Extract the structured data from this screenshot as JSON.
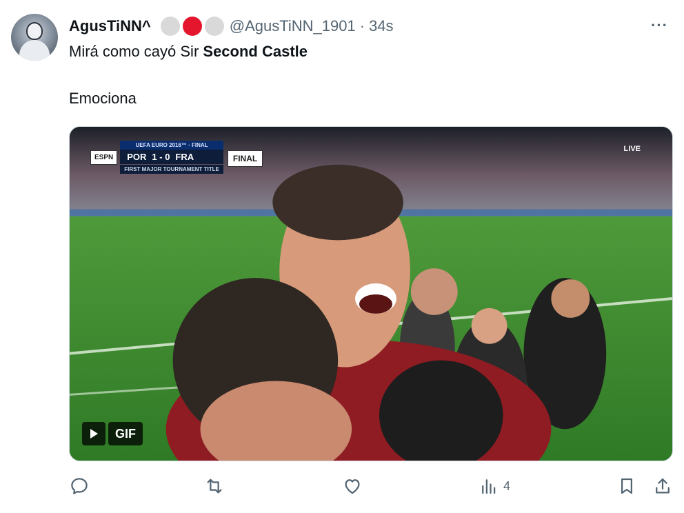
{
  "tweet": {
    "display_name": "AgusTiNN^",
    "handle": "@AgusTiNN_1901",
    "separator": "·",
    "time": "34s",
    "more_label": "···",
    "badges": [
      {
        "color": "#d9d9d9"
      },
      {
        "color": "#e3162d"
      },
      {
        "color": "#d9d9d9"
      }
    ],
    "text_line1_prefix": "Mirá como cayó Sir ",
    "text_line1_bold": "Second Castle",
    "text_line2": "Emociona"
  },
  "media": {
    "type": "gif",
    "gif_label": "GIF",
    "scoreboard": {
      "broadcaster": "ESPN",
      "tournament": "UEFA EURO 2016™ · FINAL",
      "home": "POR",
      "score": "1 - 0",
      "away": "FRA",
      "caption": "FIRST MAJOR TOURNAMENT TITLE",
      "status": "FINAL"
    },
    "live_label": "LIVE"
  },
  "actions": {
    "reply": {
      "icon": "reply-icon",
      "count": ""
    },
    "retweet": {
      "icon": "retweet-icon",
      "count": ""
    },
    "like": {
      "icon": "heart-icon",
      "count": ""
    },
    "views": {
      "icon": "views-icon",
      "count": "4"
    },
    "bookmark": {
      "icon": "bookmark-icon"
    },
    "share": {
      "icon": "share-icon"
    }
  },
  "colors": {
    "text_primary": "#0f1419",
    "text_secondary": "#536471",
    "border": "#cfd9de"
  }
}
